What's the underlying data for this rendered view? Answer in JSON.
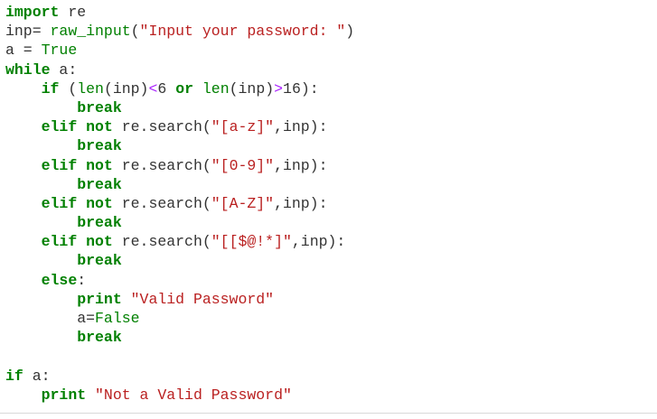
{
  "code": {
    "lines": [
      [
        {
          "t": "import",
          "c": "kw"
        },
        {
          "t": " re",
          "c": "nm"
        }
      ],
      [
        {
          "t": "inp= ",
          "c": "nm"
        },
        {
          "t": "raw_input",
          "c": "bi"
        },
        {
          "t": "(",
          "c": "nm"
        },
        {
          "t": "\"Input your password: \"",
          "c": "st"
        },
        {
          "t": ")",
          "c": "nm"
        }
      ],
      [
        {
          "t": "a = ",
          "c": "nm"
        },
        {
          "t": "True",
          "c": "bi"
        }
      ],
      [
        {
          "t": "while",
          "c": "kw"
        },
        {
          "t": " a:",
          "c": "nm"
        }
      ],
      [
        {
          "t": "    ",
          "c": "nm"
        },
        {
          "t": "if",
          "c": "kw"
        },
        {
          "t": " (",
          "c": "nm"
        },
        {
          "t": "len",
          "c": "bi"
        },
        {
          "t": "(inp)",
          "c": "nm"
        },
        {
          "t": "<",
          "c": "op"
        },
        {
          "t": "6 ",
          "c": "num"
        },
        {
          "t": "or",
          "c": "kw"
        },
        {
          "t": " ",
          "c": "nm"
        },
        {
          "t": "len",
          "c": "bi"
        },
        {
          "t": "(inp)",
          "c": "nm"
        },
        {
          "t": ">",
          "c": "op"
        },
        {
          "t": "16):",
          "c": "num"
        }
      ],
      [
        {
          "t": "        ",
          "c": "nm"
        },
        {
          "t": "break",
          "c": "kw"
        }
      ],
      [
        {
          "t": "    ",
          "c": "nm"
        },
        {
          "t": "elif",
          "c": "kw"
        },
        {
          "t": " ",
          "c": "nm"
        },
        {
          "t": "not",
          "c": "kw"
        },
        {
          "t": " re.search(",
          "c": "nm"
        },
        {
          "t": "\"[a-z]\"",
          "c": "st"
        },
        {
          "t": ",inp):",
          "c": "nm"
        }
      ],
      [
        {
          "t": "        ",
          "c": "nm"
        },
        {
          "t": "break",
          "c": "kw"
        }
      ],
      [
        {
          "t": "    ",
          "c": "nm"
        },
        {
          "t": "elif",
          "c": "kw"
        },
        {
          "t": " ",
          "c": "nm"
        },
        {
          "t": "not",
          "c": "kw"
        },
        {
          "t": " re.search(",
          "c": "nm"
        },
        {
          "t": "\"[0-9]\"",
          "c": "st"
        },
        {
          "t": ",inp):",
          "c": "nm"
        }
      ],
      [
        {
          "t": "        ",
          "c": "nm"
        },
        {
          "t": "break",
          "c": "kw"
        }
      ],
      [
        {
          "t": "    ",
          "c": "nm"
        },
        {
          "t": "elif",
          "c": "kw"
        },
        {
          "t": " ",
          "c": "nm"
        },
        {
          "t": "not",
          "c": "kw"
        },
        {
          "t": " re.search(",
          "c": "nm"
        },
        {
          "t": "\"[A-Z]\"",
          "c": "st"
        },
        {
          "t": ",inp):",
          "c": "nm"
        }
      ],
      [
        {
          "t": "        ",
          "c": "nm"
        },
        {
          "t": "break",
          "c": "kw"
        }
      ],
      [
        {
          "t": "    ",
          "c": "nm"
        },
        {
          "t": "elif",
          "c": "kw"
        },
        {
          "t": " ",
          "c": "nm"
        },
        {
          "t": "not",
          "c": "kw"
        },
        {
          "t": " re.search(",
          "c": "nm"
        },
        {
          "t": "\"[[$@!*]\"",
          "c": "st"
        },
        {
          "t": ",inp):",
          "c": "nm"
        }
      ],
      [
        {
          "t": "        ",
          "c": "nm"
        },
        {
          "t": "break",
          "c": "kw"
        }
      ],
      [
        {
          "t": "    ",
          "c": "nm"
        },
        {
          "t": "else",
          "c": "kw"
        },
        {
          "t": ":",
          "c": "nm"
        }
      ],
      [
        {
          "t": "        ",
          "c": "nm"
        },
        {
          "t": "print",
          "c": "kw"
        },
        {
          "t": " ",
          "c": "nm"
        },
        {
          "t": "\"Valid Password\"",
          "c": "st"
        }
      ],
      [
        {
          "t": "        a=",
          "c": "nm"
        },
        {
          "t": "False",
          "c": "bi"
        }
      ],
      [
        {
          "t": "        ",
          "c": "nm"
        },
        {
          "t": "break",
          "c": "kw"
        }
      ],
      [
        {
          "t": "",
          "c": "nm"
        }
      ],
      [
        {
          "t": "if",
          "c": "kw"
        },
        {
          "t": " a:",
          "c": "nm"
        }
      ],
      [
        {
          "t": "    ",
          "c": "nm"
        },
        {
          "t": "print",
          "c": "kw"
        },
        {
          "t": " ",
          "c": "nm"
        },
        {
          "t": "\"Not a Valid Password\"",
          "c": "st"
        }
      ]
    ]
  },
  "colors": {
    "keyword": "#008000",
    "string": "#ba2121",
    "builtin": "#008000",
    "operator": "#aa22ff",
    "text": "#333333",
    "background": "#ffffff"
  }
}
